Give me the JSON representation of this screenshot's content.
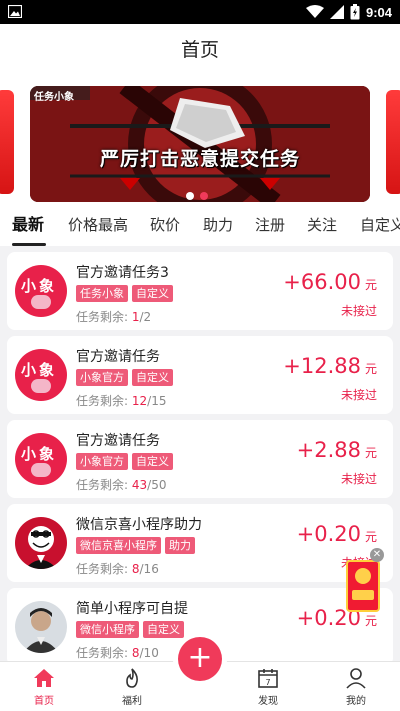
{
  "status_bar": {
    "time": "9:04"
  },
  "header": {
    "title": "首页"
  },
  "banner": {
    "tag": "任务小象",
    "headline": "严厉打击恶意提交任务",
    "slide_count": 2,
    "active_slide": 2
  },
  "tabs": [
    {
      "label": "最新",
      "active": true
    },
    {
      "label": "价格最高",
      "active": false
    },
    {
      "label": "砍价",
      "active": false
    },
    {
      "label": "助力",
      "active": false
    },
    {
      "label": "注册",
      "active": false
    },
    {
      "label": "关注",
      "active": false
    },
    {
      "label": "自定义",
      "active": false
    }
  ],
  "tasks": [
    {
      "avatar": "xiaoxiang-logo",
      "title": "官方邀请任务3",
      "tags": [
        "任务小象",
        "自定义"
      ],
      "remain_label": "任务剩余:",
      "done": "1",
      "total": "/2",
      "price": "+66.00",
      "unit": "元",
      "status": "未接过"
    },
    {
      "avatar": "xiaoxiang-logo",
      "title": "官方邀请任务",
      "tags": [
        "小象官方",
        "自定义"
      ],
      "remain_label": "任务剩余:",
      "done": "12",
      "total": "/15",
      "price": "+12.88",
      "unit": "元",
      "status": "未接过"
    },
    {
      "avatar": "xiaoxiang-logo",
      "title": "官方邀请任务",
      "tags": [
        "小象官方",
        "自定义"
      ],
      "remain_label": "任务剩余:",
      "done": "43",
      "total": "/50",
      "price": "+2.88",
      "unit": "元",
      "status": "未接过"
    },
    {
      "avatar": "kfc-logo",
      "title": "微信京喜小程序助力",
      "tags": [
        "微信京喜小程序",
        "助力"
      ],
      "remain_label": "任务剩余:",
      "done": "8",
      "total": "/16",
      "price": "+0.20",
      "unit": "元",
      "status": "未接过"
    },
    {
      "avatar": "person-photo",
      "title": "简单小程序可自提",
      "tags": [
        "微信小程序",
        "自定义"
      ],
      "remain_label": "任务剩余:",
      "done": "8",
      "total": "/10",
      "price": "+0.20",
      "unit": "元",
      "status": "未接过"
    }
  ],
  "avatar_text": {
    "left": "小",
    "right": "象"
  },
  "calendar_day": "7",
  "bottom_nav": [
    {
      "label": "首页",
      "icon": "home-icon",
      "active": true
    },
    {
      "label": "福利",
      "icon": "flame-icon",
      "active": false
    },
    {
      "label": "发现",
      "icon": "calendar-icon",
      "active": false
    },
    {
      "label": "我的",
      "icon": "user-icon",
      "active": false
    }
  ],
  "fab": {
    "symbol": "+"
  },
  "colors": {
    "accent": "#e8214a",
    "tag_bg": "#ee5a78",
    "fab": "#f03a5a"
  }
}
